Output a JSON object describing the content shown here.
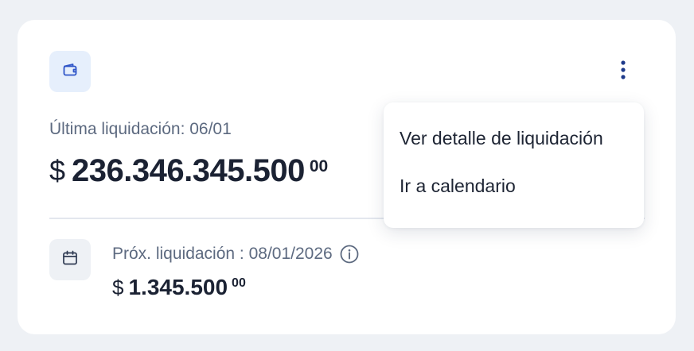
{
  "card": {
    "last_settlement_label": "Última liquidación: 06/01",
    "last_amount": {
      "currency": "$",
      "value": "236.346.345.500",
      "cents": "00"
    },
    "next_settlement_label": "Próx. liquidación : 08/01/2026",
    "next_amount": {
      "currency": "$",
      "value": "1.345.500",
      "cents": "00"
    }
  },
  "menu": {
    "items": [
      {
        "label": "Ver detalle de liquidación"
      },
      {
        "label": "Ir a calendario"
      }
    ]
  },
  "icons": {
    "wallet": "wallet-icon",
    "more": "more-vertical-icon",
    "calendar": "calendar-icon",
    "info": "info-icon"
  },
  "colors": {
    "background": "#eef1f5",
    "card": "#ffffff",
    "accent": "#2f55c8",
    "wallet_badge": "#e6effc",
    "muted_text": "#5d6a80",
    "dark_text": "#1b2233"
  }
}
